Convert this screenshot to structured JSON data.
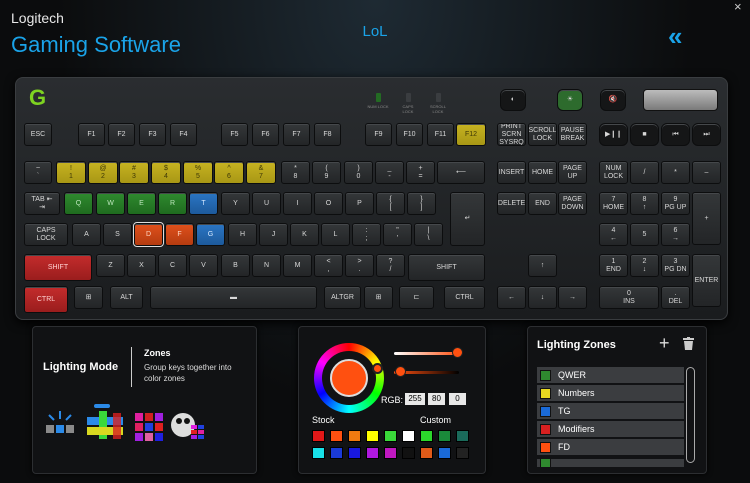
{
  "header": {
    "brand": "Logitech",
    "app_name": "Gaming Software",
    "profile": "LoL",
    "collapse_icon": "«",
    "close_icon": "×"
  },
  "indicators": {
    "num": "NUM LOCK",
    "caps": "CAPS LOCK",
    "scroll": "SCROLL LOCK"
  },
  "keys": {
    "esc": "ESC",
    "f1": "F1",
    "f2": "F2",
    "f3": "F3",
    "f4": "F4",
    "f5": "F5",
    "f6": "F6",
    "f7": "F7",
    "f8": "F8",
    "f9": "F9",
    "f10": "F10",
    "f11": "F11",
    "f12": "F12",
    "prtsc": "PRINT\nSCRN\nSYSRQ",
    "scroll": "SCROLL\nLOCK",
    "pause": "PAUSE\nBREAK",
    "tilde": "~\n`",
    "n1": "!\n1",
    "n2": "@\n2",
    "n3": "#\n3",
    "n4": "$\n4",
    "n5": "%\n5",
    "n6": "^\n6",
    "n7": "&\n7",
    "n8": "*\n8",
    "n9": "(\n9",
    "n0": ")\n0",
    "minus": "_\n-",
    "equal": "+\n=",
    "backspace": "⟵",
    "insert": "INSERT",
    "home": "HOME",
    "pgup": "PAGE\nUP",
    "numlock": "NUM\nLOCK",
    "npdiv": "/",
    "npmul": "*",
    "npminus": "–",
    "tab": "TAB ⇤\n⇥",
    "q": "Q",
    "w": "W",
    "e": "E",
    "r": "R",
    "t": "T",
    "y": "Y",
    "u": "U",
    "i": "I",
    "o": "O",
    "p": "P",
    "lbr": "{\n[",
    "rbr": "}\n]",
    "bslash": "|\n\\",
    "delete": "DELETE",
    "end": "END",
    "pgdn": "PAGE\nDOWN",
    "np7": "7\nHOME",
    "np8": "8\n↑",
    "np9": "9\nPG UP",
    "npplus": "+",
    "caps": "CAPS\nLOCK",
    "a": "A",
    "s": "S",
    "d": "D",
    "f": "F",
    "g": "G",
    "h": "H",
    "j": "J",
    "k": "K",
    "l": "L",
    "semi": ":\n;",
    "quote": "\"\n'",
    "enter": "↵",
    "np4": "4\n←",
    "np5": "5",
    "np6": "6\n→",
    "lshift": "SHIFT",
    "z": "Z",
    "x": "X",
    "c": "C",
    "v": "V",
    "b": "B",
    "n": "N",
    "m": "M",
    "comma": "<\n,",
    "period": ">\n.",
    "slash": "?\n/",
    "rshift": "SHIFT",
    "up": "↑",
    "np1": "1\nEND",
    "np2": "2\n↓",
    "np3": "3\nPG DN",
    "npenter": "ENTER",
    "lctrl": "CTRL",
    "lwin": "⊞",
    "lalt": "ALT",
    "space": "▬",
    "altgr": "ALTGR",
    "rwin": "⊞",
    "menu": "⊏",
    "rctrl": "CTRL",
    "left": "←",
    "down": "↓",
    "right": "→",
    "np0": "0\nINS",
    "npdot": ".\nDEL",
    "play": "▶❙❙",
    "stop": "■",
    "prev": "⏮",
    "next": "⏭"
  },
  "lighting_mode": {
    "title": "Lighting Mode",
    "zones_title": "Zones",
    "zones_desc": "Group keys together into color zones"
  },
  "color_picker": {
    "rgb_label": "RGB:",
    "r": "255",
    "g": "80",
    "b": "0",
    "stock_label": "Stock",
    "custom_label": "Custom",
    "current_color": "#ff5010",
    "stock_colors": [
      "#e01818",
      "#ff5010",
      "#f07a10",
      "#ffff00",
      "#3ad83a",
      "#ffffff",
      "#18e0e8",
      "#1a3ad8",
      "#1818e0",
      "#b018e0",
      "#c018c0",
      "#111111"
    ],
    "custom_colors": [
      "#2bd82b",
      "#1a8a3a",
      "#1a6a5a",
      "#e05a18",
      "#1a6ad8",
      "#222222"
    ]
  },
  "lighting_zones": {
    "title": "Lighting Zones",
    "add_icon": "+",
    "zones": [
      {
        "name": "QWER",
        "color": "#2f8a2f"
      },
      {
        "name": "Numbers",
        "color": "#e8d820"
      },
      {
        "name": "TG",
        "color": "#1a6ad8"
      },
      {
        "name": "Modifiers",
        "color": "#d82020"
      },
      {
        "name": "FD",
        "color": "#ff5010"
      }
    ]
  }
}
